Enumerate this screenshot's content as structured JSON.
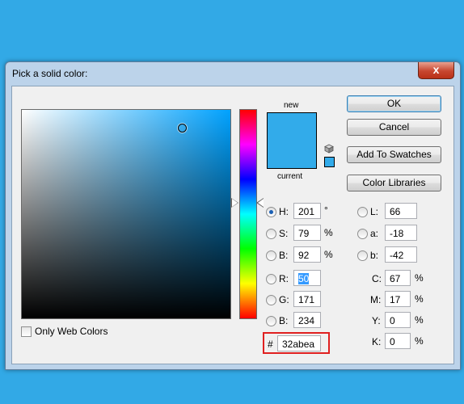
{
  "window": {
    "title": "Pick a solid color:",
    "close_glyph": "x"
  },
  "color_field": {
    "only_web_colors_label": "Only Web Colors"
  },
  "swatch": {
    "new_label": "new",
    "current_label": "current",
    "color": "#32abea"
  },
  "buttons": {
    "ok": "OK",
    "cancel": "Cancel",
    "add_to_swatches": "Add To Swatches",
    "color_libraries": "Color Libraries"
  },
  "hsb": [
    {
      "label": "H:",
      "value": "201",
      "unit": "°",
      "selected": true
    },
    {
      "label": "S:",
      "value": "79",
      "unit": "%"
    },
    {
      "label": "B:",
      "value": "92",
      "unit": "%"
    }
  ],
  "rgb": [
    {
      "label": "R:",
      "value": "50"
    },
    {
      "label": "G:",
      "value": "171"
    },
    {
      "label": "B:",
      "value": "234"
    }
  ],
  "lab": [
    {
      "label": "L:",
      "value": "66"
    },
    {
      "label": "a:",
      "value": "-18"
    },
    {
      "label": "b:",
      "value": "-42"
    }
  ],
  "cmyk": [
    {
      "label": "C:",
      "value": "67",
      "unit": "%"
    },
    {
      "label": "M:",
      "value": "17",
      "unit": "%"
    },
    {
      "label": "Y:",
      "value": "0",
      "unit": "%"
    },
    {
      "label": "K:",
      "value": "0",
      "unit": "%"
    }
  ],
  "hex": {
    "prefix": "#",
    "value": "32abea"
  }
}
